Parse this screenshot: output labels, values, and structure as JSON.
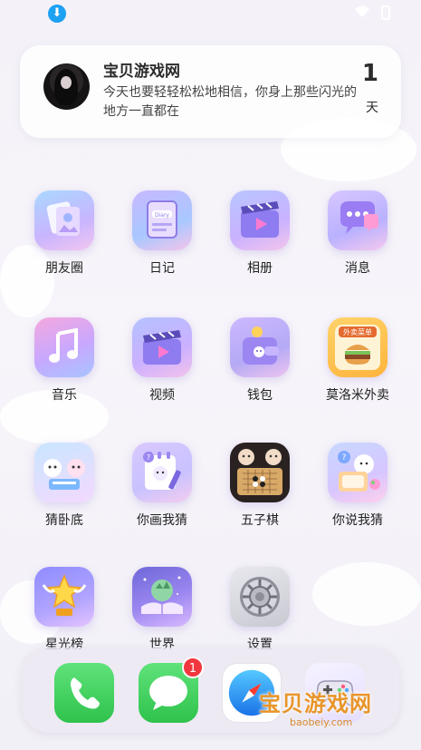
{
  "statusbar": {
    "download_icon": "download-icon"
  },
  "widget": {
    "title": "宝贝游戏网",
    "message": "今天也要轻轻松松地相信，你身上那些闪光的地方一直都在",
    "count": "1",
    "unit": "天"
  },
  "apps": [
    {
      "label": "朋友圈",
      "icon": "moments-icon"
    },
    {
      "label": "日记",
      "icon": "diary-icon"
    },
    {
      "label": "相册",
      "icon": "album-icon"
    },
    {
      "label": "消息",
      "icon": "message-icon"
    },
    {
      "label": "音乐",
      "icon": "music-icon"
    },
    {
      "label": "视频",
      "icon": "video-icon"
    },
    {
      "label": "钱包",
      "icon": "wallet-icon"
    },
    {
      "label": "莫洛米外卖",
      "icon": "food-delivery-icon",
      "icon_text": "外卖菜单"
    },
    {
      "label": "猜卧底",
      "icon": "undercover-game-icon"
    },
    {
      "label": "你画我猜",
      "icon": "draw-guess-icon"
    },
    {
      "label": "五子棋",
      "icon": "gomoku-icon"
    },
    {
      "label": "你说我猜",
      "icon": "say-guess-icon"
    },
    {
      "label": "星光榜",
      "icon": "star-ranking-icon"
    },
    {
      "label": "世界",
      "icon": "world-icon"
    },
    {
      "label": "设置",
      "icon": "settings-gear-icon"
    }
  ],
  "dock": {
    "phone_icon": "phone-icon",
    "messages_icon": "messages-icon",
    "messages_badge": "1",
    "safari_icon": "safari-compass-icon",
    "game_icon": "gamepad-icon"
  },
  "watermark": {
    "title": "宝贝游戏网",
    "url": "baobeiy.com"
  },
  "colors": {
    "accent_orange": "#e8952a",
    "badge_red": "#f0373f",
    "phone_green": "#34c759"
  }
}
